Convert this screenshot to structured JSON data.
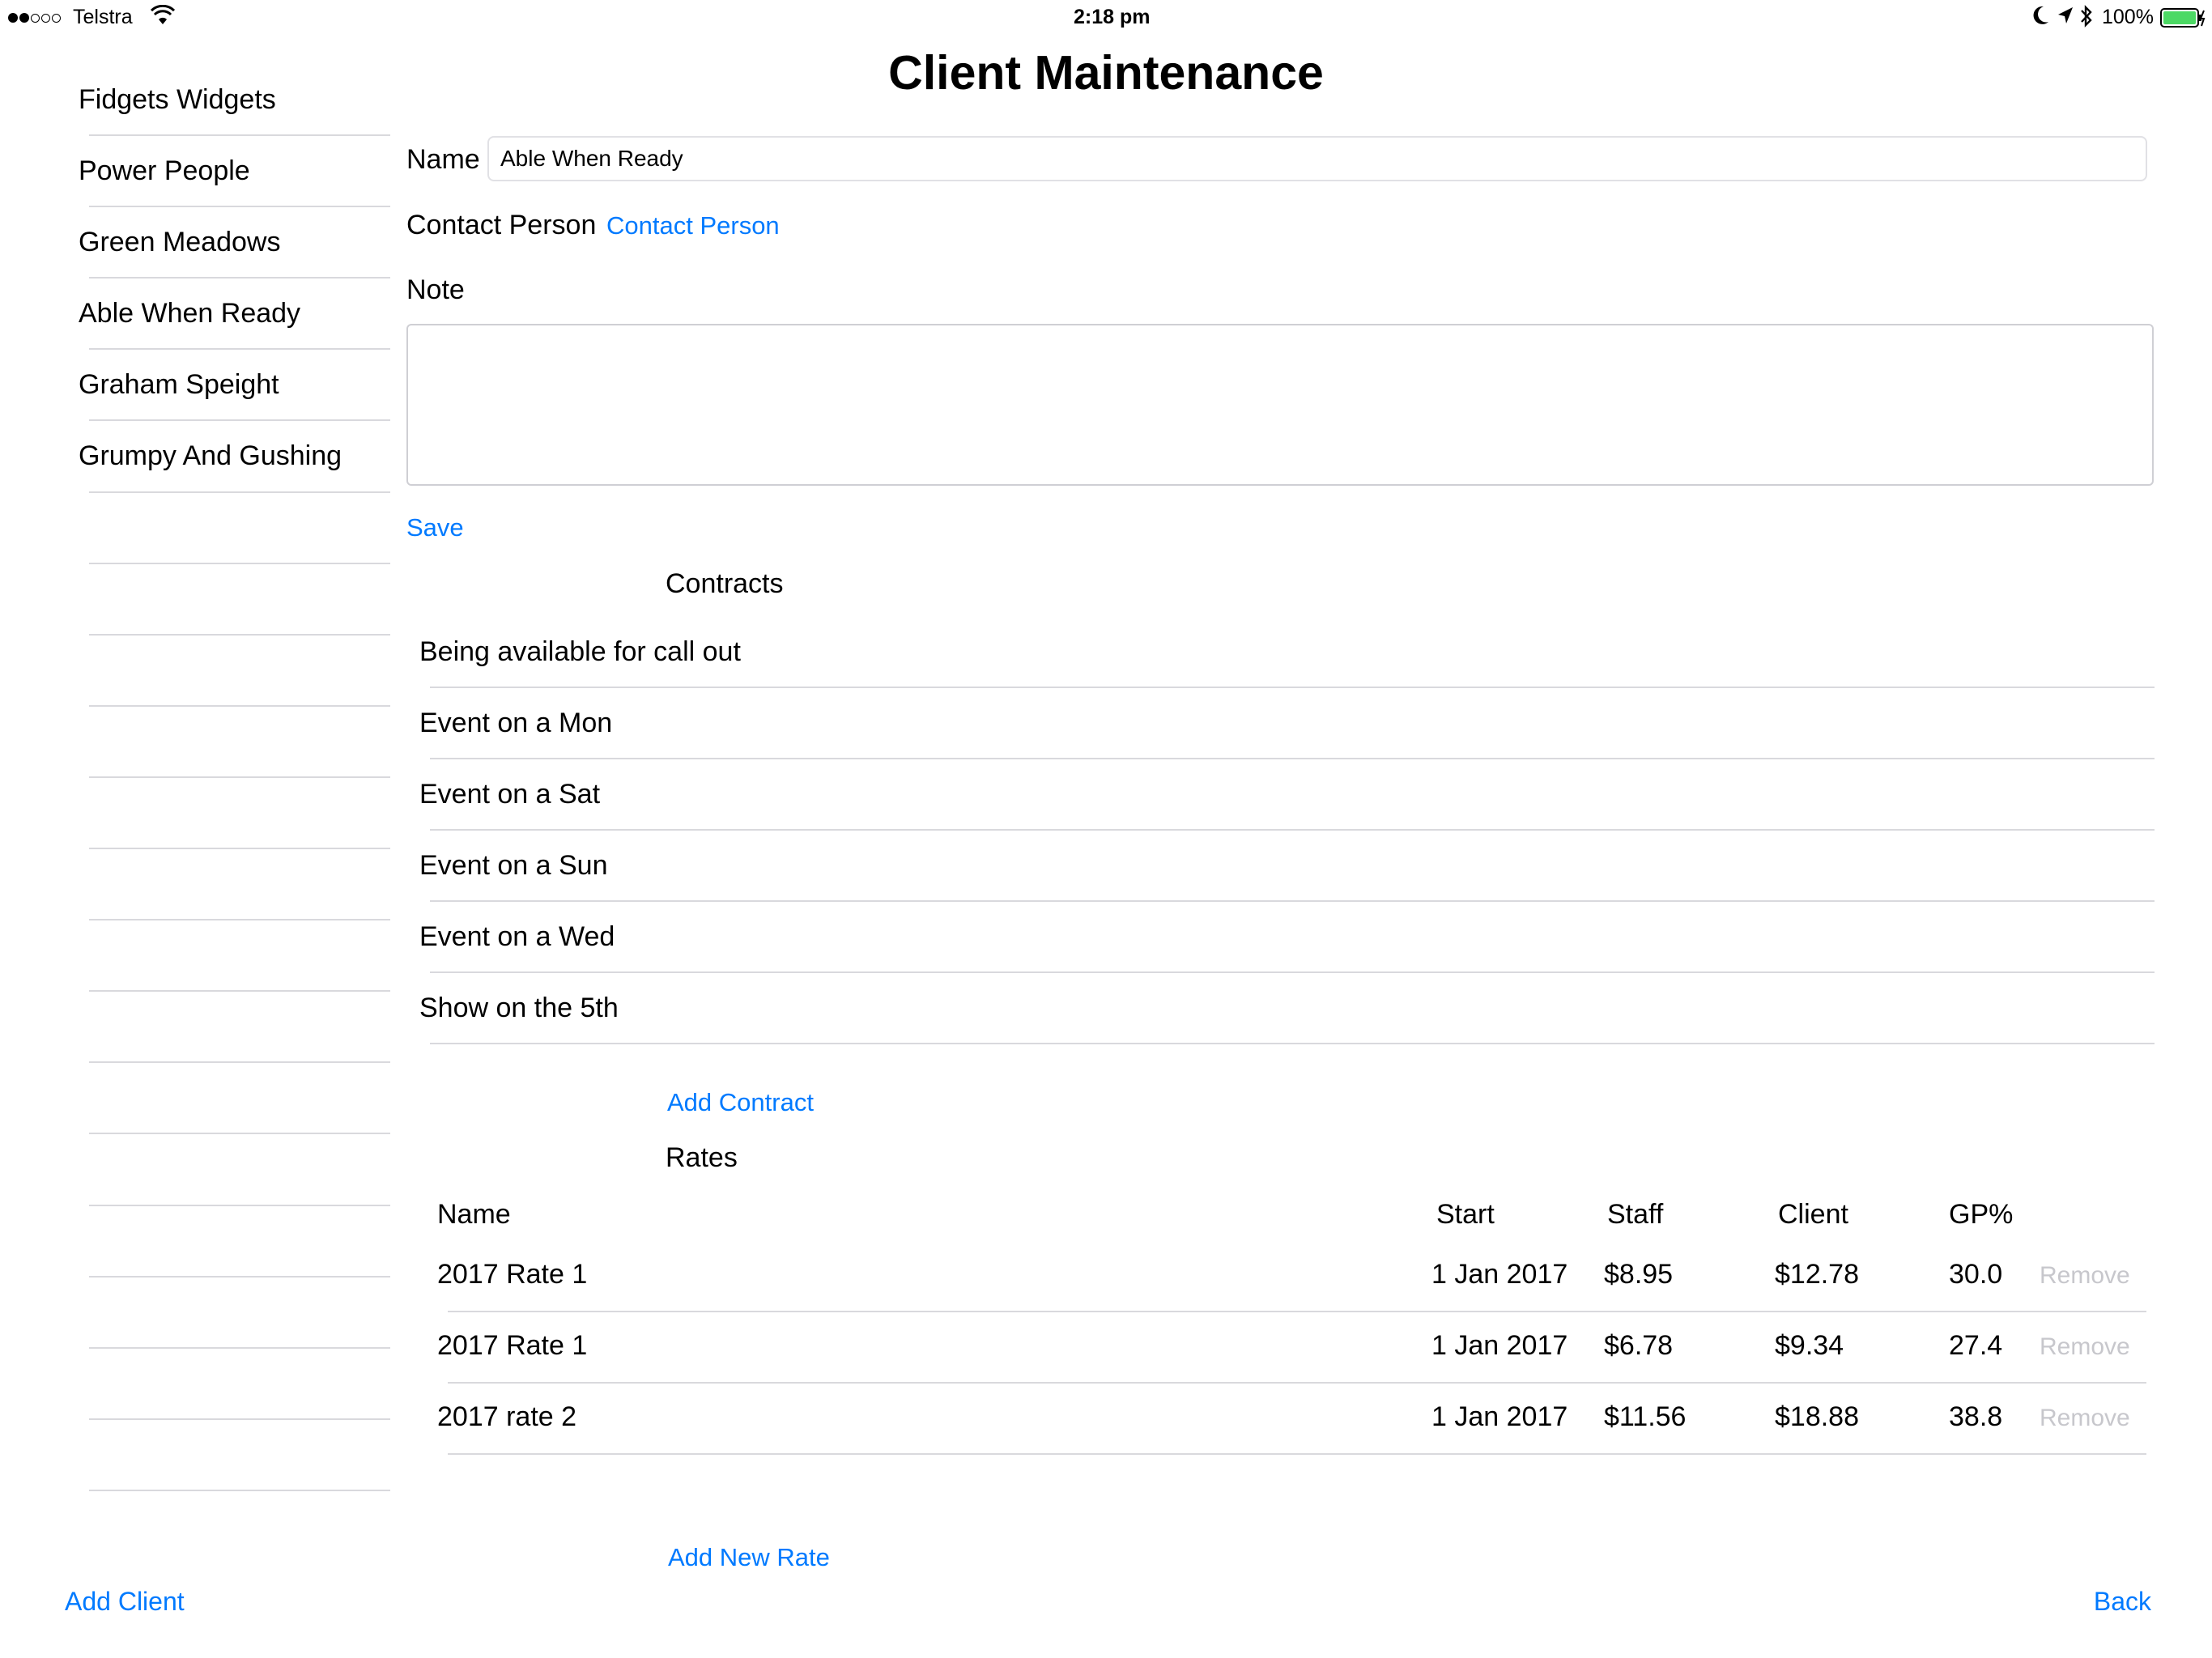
{
  "status_bar": {
    "carrier": "Telstra",
    "time": "2:18 pm",
    "battery": "100%"
  },
  "title": "Client Maintenance",
  "sidebar": {
    "items": [
      {
        "label": "Fidgets Widgets"
      },
      {
        "label": "Power People"
      },
      {
        "label": "Green Meadows"
      },
      {
        "label": "Able When Ready"
      },
      {
        "label": "Graham Speight"
      },
      {
        "label": "Grumpy And Gushing"
      }
    ],
    "add_client": "Add Client"
  },
  "form": {
    "name_label": "Name",
    "name_value": "Able When Ready",
    "contact_label": "Contact Person",
    "contact_link": "Contact Person",
    "note_label": "Note",
    "note_value": "",
    "save": "Save"
  },
  "contracts": {
    "heading": "Contracts",
    "items": [
      {
        "label": "Being available for call out"
      },
      {
        "label": "Event on a Mon"
      },
      {
        "label": "Event on a Sat"
      },
      {
        "label": "Event on a Sun"
      },
      {
        "label": "Event on a Wed"
      },
      {
        "label": "Show on the 5th"
      }
    ],
    "add": "Add Contract"
  },
  "rates": {
    "heading": "Rates",
    "columns": {
      "name": "Name",
      "start": "Start",
      "staff": "Staff",
      "client": "Client",
      "gp": "GP%"
    },
    "rows": [
      {
        "name": "2017 Rate 1",
        "start": "1 Jan 2017",
        "staff": "$8.95",
        "client": "$12.78",
        "gp": "30.0",
        "remove": "Remove"
      },
      {
        "name": "2017 Rate 1",
        "start": "1 Jan 2017",
        "staff": "$6.78",
        "client": "$9.34",
        "gp": "27.4",
        "remove": "Remove"
      },
      {
        "name": "2017 rate 2",
        "start": "1 Jan 2017",
        "staff": "$11.56",
        "client": "$18.88",
        "gp": "38.8",
        "remove": "Remove"
      }
    ],
    "add": "Add New Rate"
  },
  "back": "Back",
  "colors": {
    "accent": "#007aff",
    "separator": "#d9d9dd",
    "disabled": "#c7c7cc",
    "battery": "#4cd964"
  }
}
